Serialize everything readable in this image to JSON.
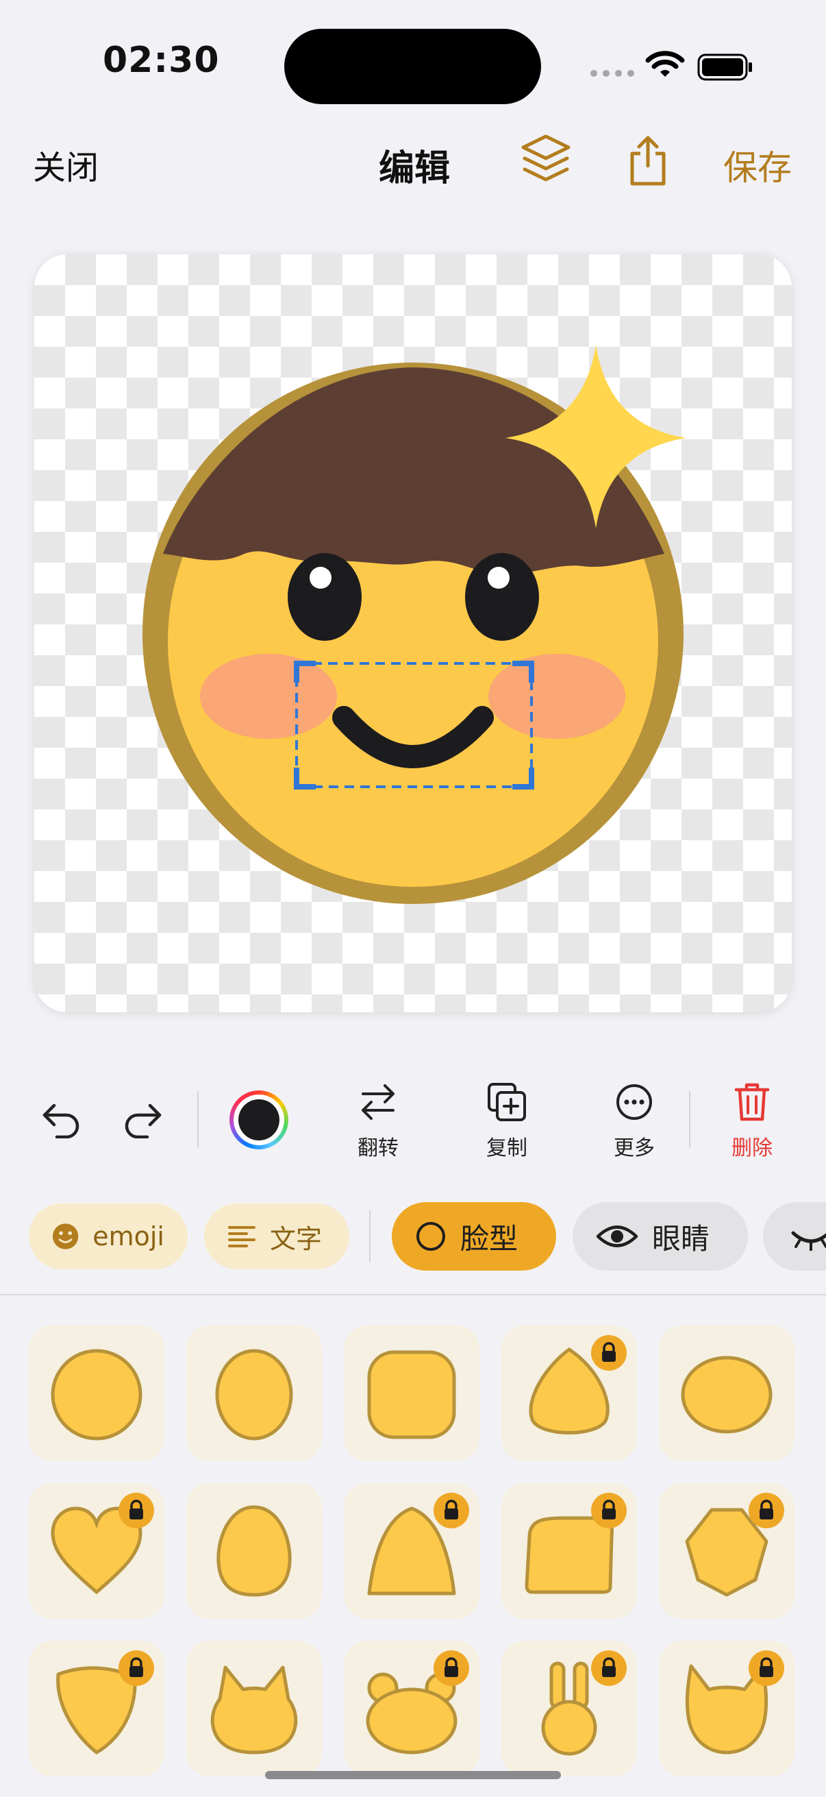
{
  "status_bar": {
    "time": "02:30"
  },
  "nav": {
    "close_label": "关闭",
    "title": "编辑",
    "save_label": "保存"
  },
  "toolbar": {
    "flip_label": "翻转",
    "duplicate_label": "复制",
    "more_label": "更多",
    "delete_label": "删除",
    "current_color": "#1C1C1E"
  },
  "categories": [
    {
      "label": "emoji",
      "style": "light"
    },
    {
      "label": "文字",
      "style": "light"
    },
    {
      "label": "脸型",
      "style": "active"
    },
    {
      "label": "眼睛",
      "style": "gray"
    }
  ],
  "colors": {
    "accent": "#B37D1E",
    "chip_active": "#EFA826",
    "delete": "#E53935",
    "selection": "#2F76D6",
    "face_fill": "#FDC94A",
    "face_outline": "#B6923A",
    "hair": "#5D3E33",
    "blush": "#FAA675",
    "sparkle": "#FFD64D"
  },
  "face_shapes": [
    {
      "name": "circle",
      "locked": false
    },
    {
      "name": "oval",
      "locked": false
    },
    {
      "name": "rounded-square",
      "locked": false
    },
    {
      "name": "egg",
      "locked": true
    },
    {
      "name": "wide-oval",
      "locked": false
    },
    {
      "name": "heart",
      "locked": true
    },
    {
      "name": "tall-egg",
      "locked": false
    },
    {
      "name": "dome",
      "locked": true
    },
    {
      "name": "box-head",
      "locked": true
    },
    {
      "name": "hexagon",
      "locked": true
    },
    {
      "name": "shield",
      "locked": true
    },
    {
      "name": "cat",
      "locked": false
    },
    {
      "name": "bear",
      "locked": true
    },
    {
      "name": "bunny",
      "locked": true
    },
    {
      "name": "fox",
      "locked": true
    }
  ]
}
